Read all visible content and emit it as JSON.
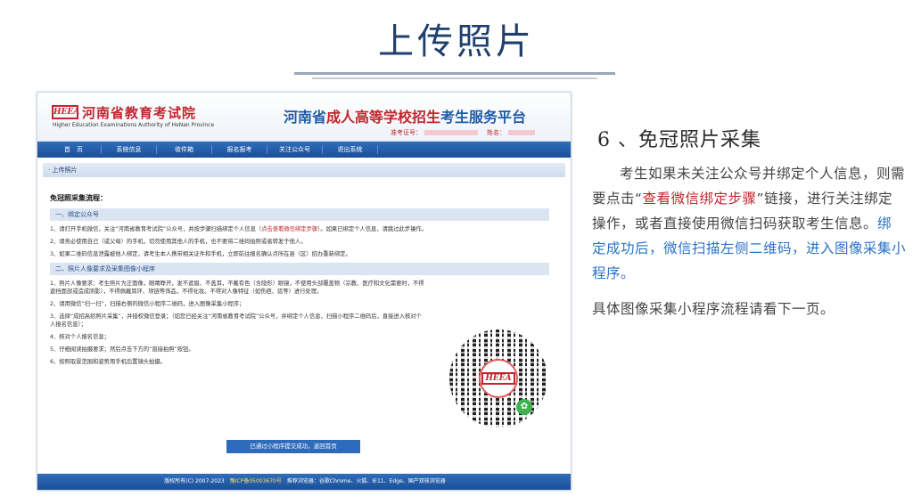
{
  "slide": {
    "title": "上传照片",
    "step_title": "6 、免冠照片采集",
    "desc_part1": "考生如果未关注公众号并绑定个人信息，则需要点击“",
    "desc_link": "查看微信绑定步骤",
    "desc_part2": "”链接，进行关注绑定操作，或者直接使用微信扫码获取考生信息。",
    "desc_blue": "绑定成功后，微信扫描左侧二维码，进入图像采集小程序。",
    "desc_next": "具体图像采集小程序流程请看下一页。"
  },
  "screenshot": {
    "logo_text": "HEEA",
    "org_name": "河南省教育考试院",
    "org_name_en": "Higher Education Examinations Authority of HeNan Province",
    "platform_title_a": "河南省",
    "platform_title_b": "成人高等学校招生",
    "platform_title_c": "考生服务平台",
    "exam_id_label": "准考证号：",
    "name_label": "姓名：",
    "nav": [
      "首　页",
      "系统信息",
      "收件箱",
      "报名报考",
      "关注公众号",
      "退出系统"
    ],
    "breadcrumb": "· 上传照片",
    "flow_title": "免冠照采集流程：",
    "section1_title": "一、绑定公众号",
    "s1_p1_a": "1、请打开手机微信，关注“河南省教育考试院”公众号，并按步骤扫描绑定个人信息（",
    "s1_p1_link": "点击查看微信绑定步骤",
    "s1_p1_b": "）。如果已绑定个人信息，请跳过此步操作。",
    "s1_p2": "2、请务必使用自己（或父母）的手机，切勿使用其他人的手机，也不要将二维码拍照或者转发于他人。",
    "s1_p3": "3、如果二维码信息泄露被他人绑定，请考生本人携带相关证件和手机，立即前往报名确认点所在县（区）招办重新绑定。",
    "section2_title": "二、照片人像要求及采集图像小程序",
    "s2_p1": "1、照片人像要求：考生照片为正面像，眼睛睁开，发不遮眉、不盖耳，不戴有色（含隐形）眼镜，不使用头部覆盖物（宗教、医疗和文化需要时，不得遮挡面部或造成阴影），不得佩戴耳环、项链等饰品，不得化妆。不得对人像特征（如伤疤、痣等）进行处理。",
    "s2_p2": "2、请用微信“扫一扫”，扫描右侧的微信小程序二维码，进入图像采集小程序；",
    "s2_p3": "3、选择“成招高招照片采集”，并授权微信登录；（如您已经关注“河南省教育考试院”公众号，并绑定个人信息，扫描小程序二维码后，直接进入核对个人报名信息）；",
    "s2_p4": "4、核对个人报名信息；",
    "s2_p5": "5、仔细阅读拍摄要求；然后点击下方的“直接拍照”按钮。",
    "s2_p6": "6、按照取景范围和姿势用手机后置镜头拍摄。",
    "qr_logo": "HEEA",
    "done_button": "已通过小程序提交成功，返回首页",
    "footer_a": "版权所有(C) 2007-2023　",
    "footer_icp": "豫ICP备05003670号",
    "footer_b": "　推荐浏览器：谷歌Chrome、火狐、IE11、Edge、国产双核浏览器"
  },
  "colors": {
    "title_blue": "#1f3f6e",
    "accent_red": "#c0262d",
    "link_blue": "#2a72c5",
    "nav_blue": "#1b4f98"
  }
}
